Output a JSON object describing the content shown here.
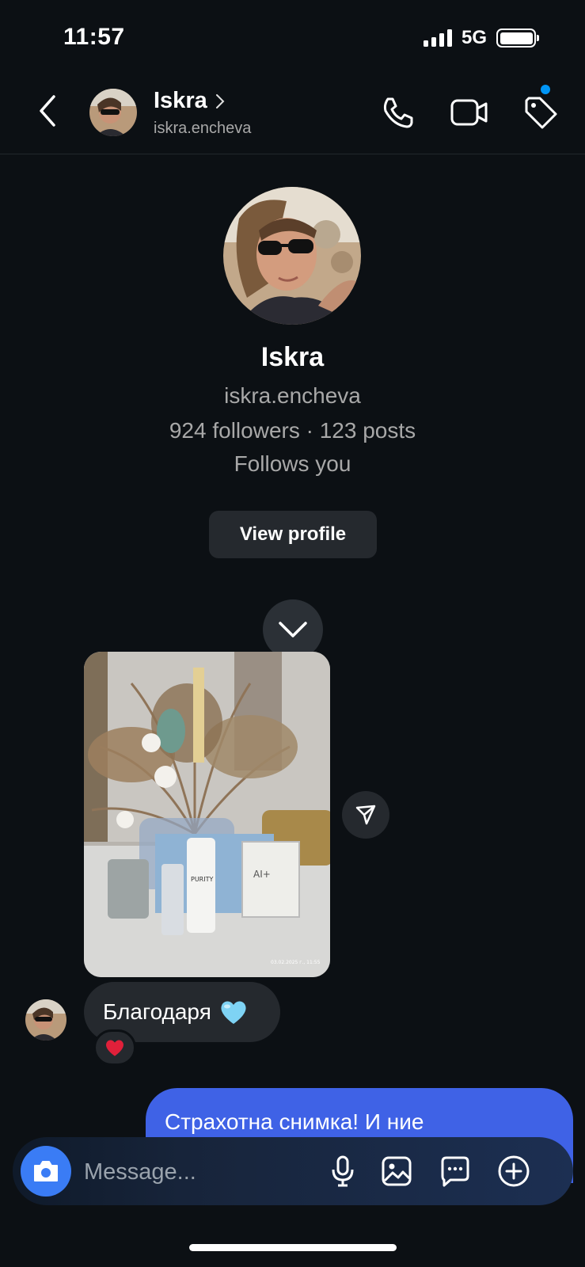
{
  "status_bar": {
    "time": "11:57",
    "network": "5G",
    "signal_bars": 4,
    "battery_level": 1.0
  },
  "header": {
    "name": "Iskra",
    "username": "iskra.encheva",
    "icons": [
      "back-icon",
      "phone-icon",
      "video-icon",
      "tag-icon"
    ],
    "notification_dot_color": "#0095f6"
  },
  "profile": {
    "name": "Iskra",
    "username": "iskra.encheva",
    "stats": "924 followers · 123 posts",
    "follows": "Follows you",
    "view_profile_label": "View profile"
  },
  "chat": {
    "incoming_text": "Благодаря",
    "incoming_emoji": "blue-heart",
    "reaction": "red-heart",
    "outgoing_line1": "Страхотна снимка! И ние",
    "photo_stamp": "03.02.2025 г., 11:55"
  },
  "composer": {
    "placeholder": "Message...",
    "icons": [
      "camera-icon",
      "microphone-icon",
      "gallery-icon",
      "sticker-icon",
      "plus-icon"
    ],
    "accent": "#3a7cf5"
  },
  "colors": {
    "background": "#0c1014",
    "outgoing_bubble": "#3f62e6",
    "incoming_bubble": "#25292e"
  }
}
